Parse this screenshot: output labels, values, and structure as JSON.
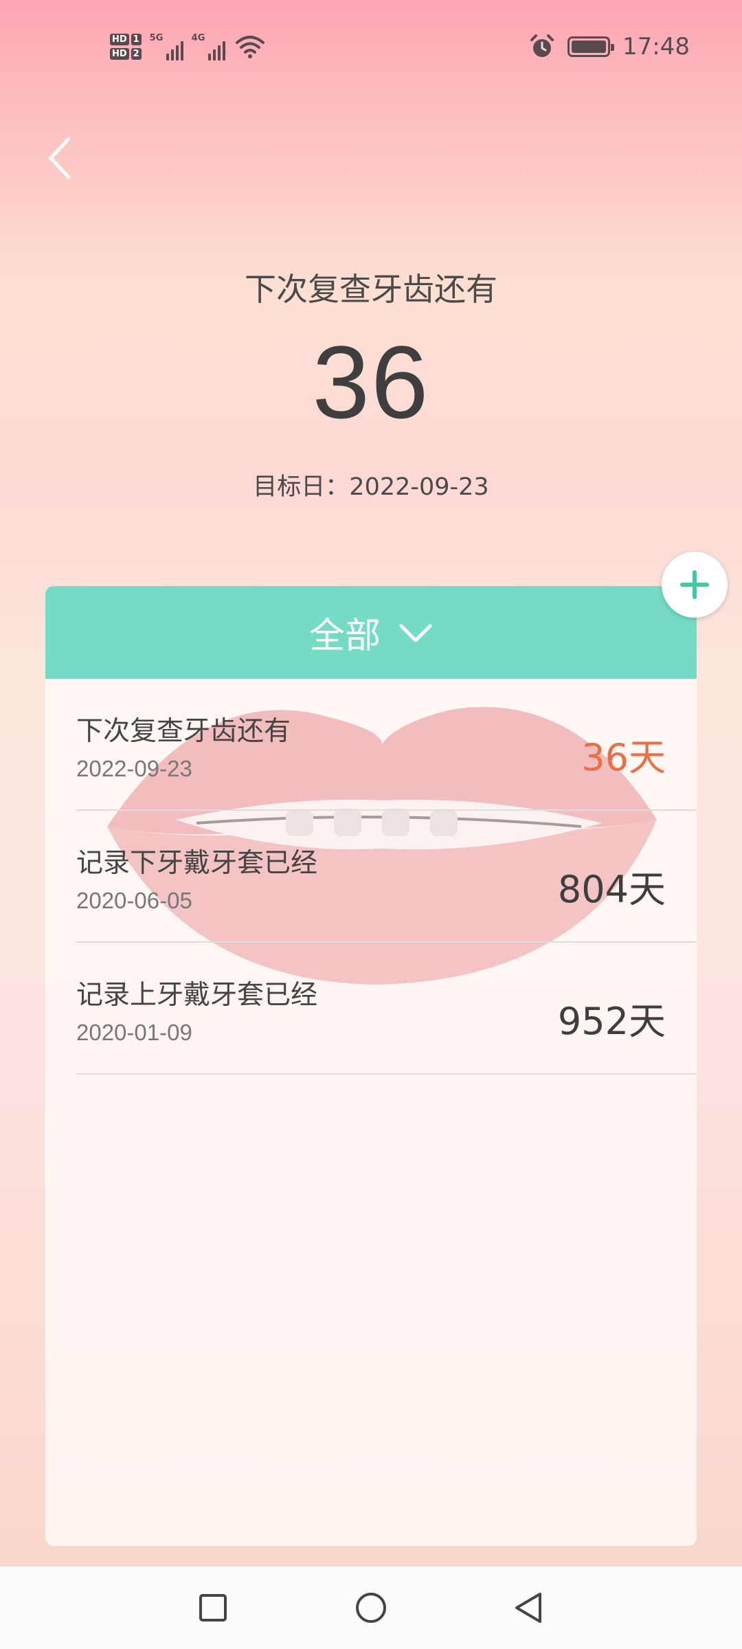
{
  "status_bar": {
    "hd1": "HD",
    "hd1_num": "1",
    "hd2": "HD",
    "hd2_num": "2",
    "sig1_label": "5G",
    "sig2_label": "4G",
    "time": "17:48",
    "battery_level": 1.0,
    "icons": [
      "wifi-icon",
      "alarm-icon",
      "battery-icon"
    ]
  },
  "header": {
    "title": "下次复查牙齿还有",
    "count": "36",
    "target_label": "目标日：2022-09-23"
  },
  "list": {
    "filter_label": "全部",
    "items": [
      {
        "title": "下次复查牙齿还有",
        "date": "2022-09-23",
        "value": "36天",
        "accent": true
      },
      {
        "title": "记录下牙戴牙套已经",
        "date": "2020-06-05",
        "value": "804天",
        "accent": false
      },
      {
        "title": "记录上牙戴牙套已经",
        "date": "2020-01-09",
        "value": "952天",
        "accent": false
      }
    ]
  },
  "colors": {
    "accent_teal": "#74dcc5",
    "accent_orange": "#ea6f45",
    "text_dark": "#444444"
  }
}
